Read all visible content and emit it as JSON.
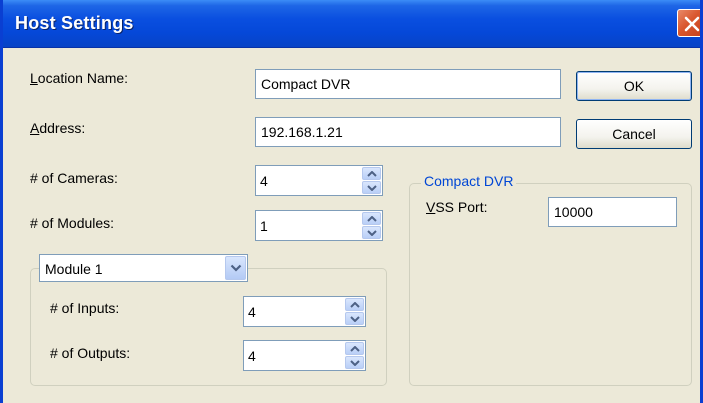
{
  "window": {
    "title": "Host Settings",
    "close_icon": "close-icon"
  },
  "form": {
    "location_label_u": "L",
    "location_label_rest": "ocation Name:",
    "location_value": "Compact DVR",
    "address_label_u": "A",
    "address_label_rest": "ddress:",
    "address_value": "192.168.1.21",
    "cameras_label": "# of Cameras:",
    "cameras_value": "4",
    "modules_label": "# of Modules:",
    "modules_value": "1"
  },
  "buttons": {
    "ok_label": "OK",
    "cancel_label": "Cancel"
  },
  "module_group": {
    "selected_module": "Module 1",
    "inputs_label": "# of Inputs:",
    "inputs_value": "4",
    "outputs_label": "# of Outputs:",
    "outputs_value": "4"
  },
  "dvr_group": {
    "caption": "Compact DVR",
    "vss_label_u": "V",
    "vss_label_rest": "SS Port:",
    "vss_value": "10000"
  },
  "colors": {
    "titlebar": "#0548D8",
    "dialog_bg": "#ECE9D8",
    "group_caption": "#0046D5",
    "close_button": "#D9572E"
  }
}
